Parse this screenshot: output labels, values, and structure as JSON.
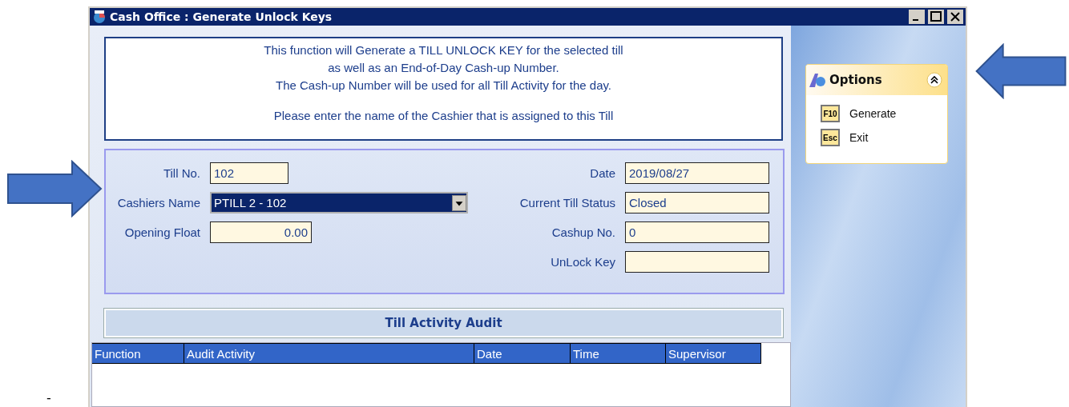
{
  "window": {
    "title": "Cash Office : Generate Unlock Keys"
  },
  "info": {
    "lines": [
      "This function will Generate a TILL UNLOCK KEY for the selected till",
      "as well as an End-of-Day Cash-up Number.",
      "The Cash-up Number will be used for all Till Activity for the day."
    ],
    "prompt": "Please enter the name of the Cashier that is assigned to this Till"
  },
  "form": {
    "left": [
      {
        "kind": "text",
        "label": "Till No.",
        "value": "102"
      },
      {
        "kind": "dropdown",
        "label": "Cashiers Name",
        "value": "PTILL 2 - 102",
        "selected": true
      },
      {
        "kind": "amount",
        "label": "Opening Float",
        "value": "0.00"
      }
    ],
    "right": [
      {
        "label": "Date",
        "value": "2019/08/27"
      },
      {
        "label": "Current Till Status",
        "value": "Closed"
      },
      {
        "label": "Cashup No.",
        "value": "0"
      },
      {
        "label": "UnLock Key"
      }
    ]
  },
  "audit": {
    "title": "Till Activity Audit",
    "columns": [
      "Function",
      "Audit Activity",
      "Date",
      "Time",
      "Supervisor"
    ]
  },
  "options": {
    "title": "Options",
    "expanded": true,
    "items": [
      {
        "key": "F10",
        "label": "Generate"
      },
      {
        "key": "Esc",
        "label": "Exit"
      }
    ]
  },
  "stray_mark": "-"
}
